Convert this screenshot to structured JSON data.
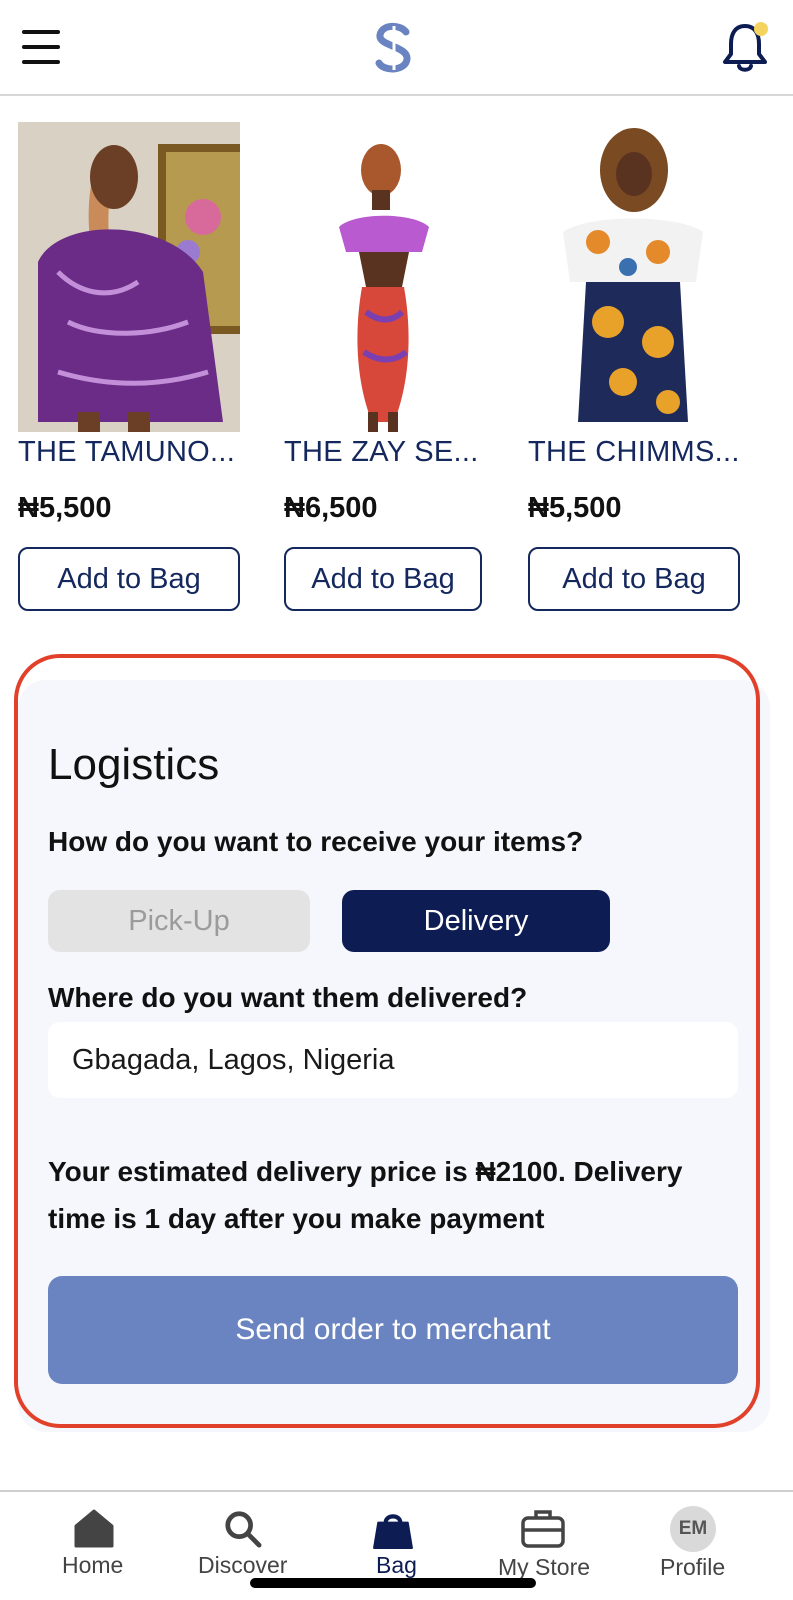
{
  "header": {
    "menu_icon": "hamburger-menu-icon",
    "logo_icon": "app-logo-s-icon",
    "notification_icon": "bell-icon",
    "notification_dot_color": "#f4d35e"
  },
  "products": [
    {
      "name": "THE TAMUNO...",
      "price": "₦5,500",
      "button": "Add to Bag"
    },
    {
      "name": "THE ZAY SE...",
      "price": "₦6,500",
      "button": "Add to Bag"
    },
    {
      "name": "THE CHIMMS...",
      "price": "₦5,500",
      "button": "Add to Bag"
    }
  ],
  "logistics": {
    "title": "Logistics",
    "receive_question": "How do you want to receive your items?",
    "options": [
      "Pick-Up",
      "Delivery"
    ],
    "selected_option": "Delivery",
    "delivery_question": "Where do you want them delivered?",
    "address_value": "Gbagada, Lagos, Nigeria",
    "estimate_text": "Your estimated delivery price is ₦2100. Delivery time is 1 day after you make payment",
    "send_button": "Send order to merchant"
  },
  "tabbar": {
    "tabs": [
      {
        "label": "Home",
        "icon": "home-icon"
      },
      {
        "label": "Discover",
        "icon": "search-icon"
      },
      {
        "label": "Bag",
        "icon": "bag-icon"
      },
      {
        "label": "My Store",
        "icon": "briefcase-icon"
      },
      {
        "label": "Profile",
        "icon": "avatar-icon",
        "avatar_initials": "EM"
      }
    ],
    "active": "Bag"
  },
  "colors": {
    "brand_navy": "#0d1c53",
    "link_navy": "#14285e",
    "send_button": "#6a84c1",
    "highlight_outline": "#e1412a",
    "card_bg": "#f6f7fc"
  }
}
